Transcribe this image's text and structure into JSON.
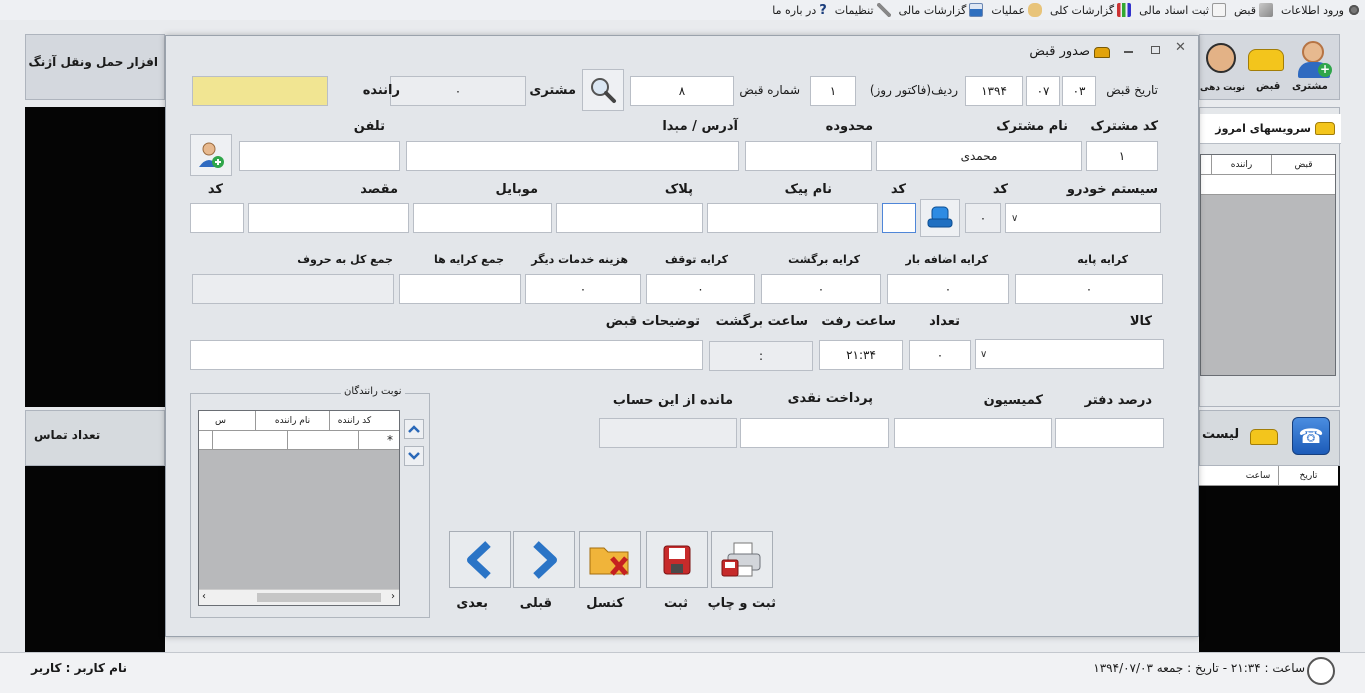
{
  "topmenu": {
    "items": [
      {
        "label": "ورود اطلاعات",
        "icon": "gear-icon"
      },
      {
        "label": "قبض",
        "icon": "receipt-icon"
      },
      {
        "label": "ثبت اسناد مالی",
        "icon": "document-icon"
      },
      {
        "label": "گزارشات کلی",
        "icon": "bar-chart-icon"
      },
      {
        "label": "عملیات",
        "icon": "hand-icon"
      },
      {
        "label": "گزارشات مالی",
        "icon": "chart-icon"
      },
      {
        "label": "تنظیمات",
        "icon": "tools-icon"
      },
      {
        "label": "در باره ما",
        "icon": "question-icon"
      }
    ]
  },
  "background": {
    "left_title": "افزار حمل ونقل آژنگ",
    "contacts_label": "تعداد تماس",
    "right_toolbar": [
      "مشتری",
      "قبض",
      "نوبت دهی"
    ],
    "services_tab": "سرویسهای امروز",
    "services_columns": [
      "قبض",
      "راننده"
    ],
    "list_label": "لیست",
    "list_columns": [
      "تاریخ",
      "ساعت"
    ]
  },
  "status": {
    "user": "نام کاربر : کاربر",
    "time": "ساعت : ۲۱:۳۴ - تاریخ : جمعه ۱۳۹۴/۰۷/۰۳"
  },
  "dialog": {
    "title": "صدور قبض",
    "row1": {
      "date_label": "تاریخ قبض",
      "day": "۰۳",
      "month": "۰۷",
      "year": "۱۳۹۴",
      "row_label": "ردیف(فاکتور روز)",
      "row_value": "۱",
      "receipt_no_label": "شماره قبض",
      "receipt_no": "۸",
      "customer_label": "مشتری",
      "customer_value": "۰",
      "driver_label": "راننده",
      "driver_value": ""
    },
    "row2": {
      "cust_code_label": "کد مشترک",
      "cust_code": "۱",
      "cust_name_label": "نام مشترک",
      "cust_name": "محمدی",
      "area_label": "محدوده",
      "area": "",
      "address_label": "آدرس / مبدا",
      "address": "",
      "phone_label": "تلفن",
      "phone": ""
    },
    "row3": {
      "vehicle_label": "سیستم خودرو",
      "vehicle": "",
      "code1_label": "کد",
      "code1": "۰",
      "code2_label": "کد",
      "code2": "",
      "courier_label": "نام پیک",
      "courier": "",
      "plate_label": "پلاک",
      "plate": "",
      "mobile_label": "موبایل",
      "mobile": "",
      "dest_label": "مقصد",
      "dest": "",
      "code3_label": "کد",
      "code3": ""
    },
    "row4": {
      "base_fare_label": "کرایه پایه",
      "base_fare": "۰",
      "extra_load_label": "کرایه اضافه بار",
      "extra_load": "۰",
      "return_fare_label": "کرایه برگشت",
      "return_fare": "۰",
      "stop_fare_label": "کرایه توقف",
      "stop_fare": "۰",
      "other_cost_label": "هزینه خدمات دیگر",
      "other_cost": "۰",
      "sum_fares_label": "جمع کرایه ها",
      "sum_fares": "",
      "total_words_label": "جمع کل به حروف",
      "total_words": ""
    },
    "row5": {
      "goods_label": "کالا",
      "goods": "",
      "count_label": "تعداد",
      "count": "۰",
      "depart_label": "ساعت رفت",
      "depart": "۲۱:۳۴",
      "return_label": "ساعت برگشت",
      "return_time": ":",
      "desc_label": "توضیحات قبض",
      "desc": ""
    },
    "row6": {
      "office_pct_label": "درصد دفتر",
      "office_pct": "",
      "commission_label": "کمیسیون",
      "commission": "",
      "cash_label": "پرداخت نقدی",
      "cash": "",
      "balance_label": "مانده از این حساب",
      "balance": ""
    },
    "drivers_queue": {
      "title": "نوبت رانندگان",
      "columns": [
        "کد راننده",
        "نام راننده",
        "س"
      ],
      "new_row_marker": "*"
    },
    "actions": {
      "save_print": "ثبت و چاپ",
      "save": "ثبت",
      "cancel": "کنسل",
      "prev": "قبلی",
      "next": "بعدی"
    }
  }
}
